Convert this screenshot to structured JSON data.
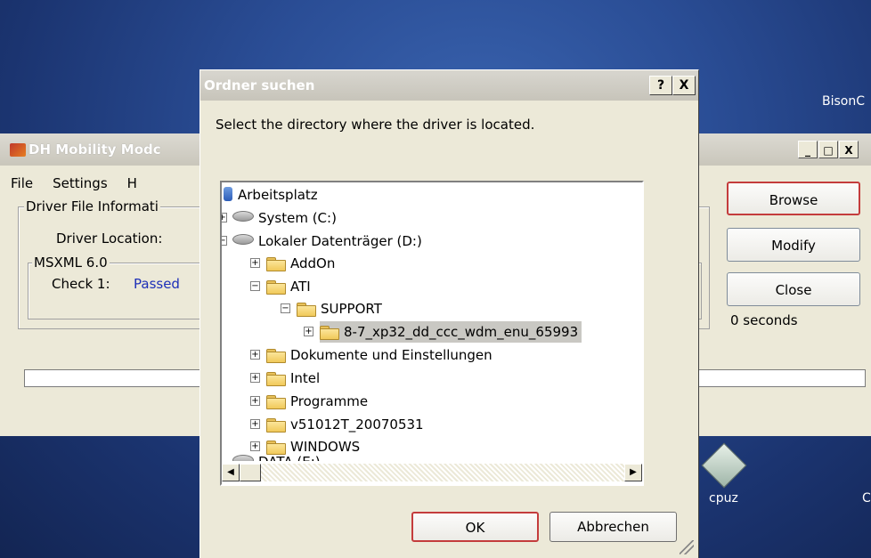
{
  "desktop": {
    "label_top_right": "BisonC",
    "icon_cpuz_label": "cpuz",
    "label_right_edge": "C"
  },
  "app": {
    "title": "DH Mobility Modc",
    "menu": [
      "File",
      "Settings",
      "H"
    ],
    "group1_label": "Driver File Informati",
    "driver_location_label": "Driver Location:",
    "group2_label": "MSXML 6.0",
    "check_label": "Check 1:",
    "check_value": "Passed",
    "buttons": {
      "browse": "Browse",
      "modify": "Modify",
      "close": "Close"
    },
    "status_text": "0 seconds",
    "window_buttons": [
      "_",
      "□",
      "X"
    ]
  },
  "dialog": {
    "title": "Ordner suchen",
    "help_button": "?",
    "close_button": "X",
    "instruction": "Select the directory where the driver is located.",
    "tree": {
      "root": "Arbeitsplatz",
      "drive_c": "System (C:)",
      "drive_d": "Lokaler Datenträger (D:)",
      "addon": "AddOn",
      "ati": "ATI",
      "support": "SUPPORT",
      "selected_folder": "8-7_xp32_dd_ccc_wdm_enu_65993",
      "dokumente": "Dokumente und Einstellungen",
      "intel": "Intel",
      "programme": "Programme",
      "v51012t": "v51012T_20070531",
      "windows": "WINDOWS",
      "drive_e": "DATA (E:)"
    },
    "ok_label": "OK",
    "cancel_label": "Abbrechen"
  }
}
